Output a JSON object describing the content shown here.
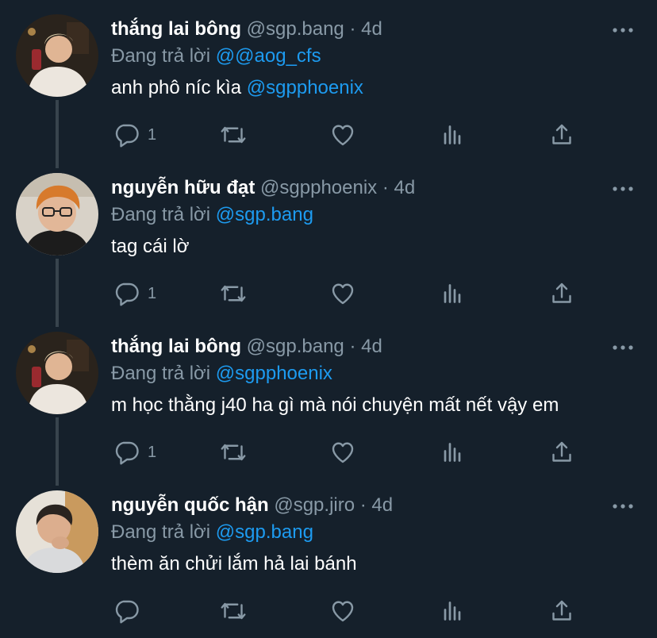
{
  "colors": {
    "background": "#15202b",
    "text": "#ffffff",
    "muted": "#8899a6",
    "mention": "#1d9bf0",
    "thread_line": "#38444d"
  },
  "tweets": [
    {
      "display_name": "thắng lai bông",
      "handle": "@sgp.bang",
      "separator": "·",
      "time": "4d",
      "reply_prefix": "Đang trả lời",
      "reply_to": "@@aog_cfs",
      "body_text": "anh phô níc kìa ",
      "body_mention": "@sgpphoenix",
      "reply_count": "1",
      "avatar_icon": "avatar-photo-icon"
    },
    {
      "display_name": "nguyễn hữu đạt",
      "handle": "@sgpphoenix",
      "separator": "·",
      "time": "4d",
      "reply_prefix": "Đang trả lời",
      "reply_to": "@sgp.bang",
      "body_text": "tag cái lờ",
      "body_mention": "",
      "reply_count": "1",
      "avatar_icon": "avatar-photo-icon"
    },
    {
      "display_name": "thắng lai bông",
      "handle": "@sgp.bang",
      "separator": "·",
      "time": "4d",
      "reply_prefix": "Đang trả lời",
      "reply_to": "@sgpphoenix",
      "body_text": "m học thằng j40 ha gì mà nói chuyện mất nết vậy em",
      "body_mention": "",
      "reply_count": "1",
      "avatar_icon": "avatar-photo-icon"
    },
    {
      "display_name": "nguyễn quốc hận",
      "handle": "@sgp.jiro",
      "separator": "·",
      "time": "4d",
      "reply_prefix": "Đang trả lời",
      "reply_to": "@sgp.bang",
      "body_text": "thèm ăn chửi lắm hả lai bánh",
      "body_mention": "",
      "reply_count": "",
      "avatar_icon": "avatar-photo-icon"
    }
  ],
  "action_icons": [
    "reply-icon",
    "retweet-icon",
    "like-icon",
    "analytics-icon",
    "share-icon",
    "more-icon"
  ]
}
